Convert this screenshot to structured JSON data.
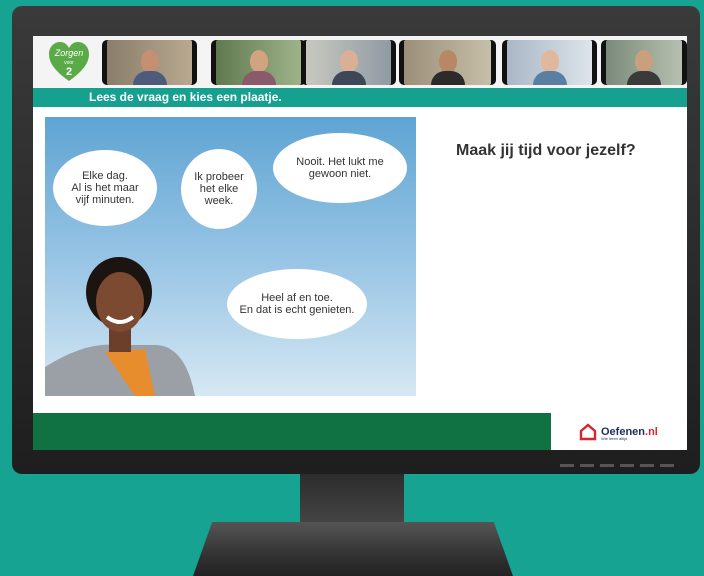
{
  "header": {
    "logo_text_line1": "Zorgen",
    "logo_text_line2": "voor",
    "logo_text_line3": "2",
    "participants": [
      {
        "icon": "participant-video"
      },
      {
        "icon": "participant-video"
      },
      {
        "icon": "participant-video"
      },
      {
        "icon": "participant-video"
      },
      {
        "icon": "participant-video"
      },
      {
        "icon": "participant-video"
      }
    ]
  },
  "banner": {
    "instruction": "Lees de vraag en kies een plaatje."
  },
  "image": {
    "bubbles": [
      "Elke dag.\nAl is het maar\nvijf minuten.",
      "Ik probeer\nhet elke\nweek.",
      "Nooit. Het lukt me\ngewoon niet.",
      "Heel af en toe.\nEn dat is echt genieten."
    ]
  },
  "question": "Maak jij tijd voor jezelf?",
  "footer": {
    "brand": "Oefenen",
    "brand_tld": ".nl",
    "brand_sub": "Wie leren altijd"
  },
  "colors": {
    "accent": "#16a08f",
    "footer_green": "#107142",
    "background": "#17a392"
  }
}
